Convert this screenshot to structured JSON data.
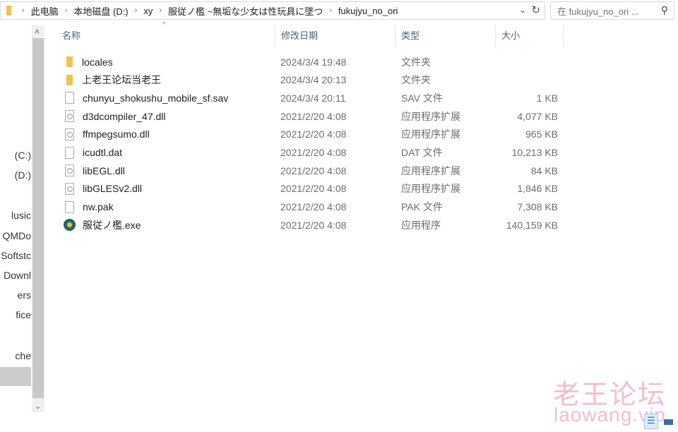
{
  "address_bar": {
    "crumbs": [
      "此电脑",
      "本地磁盘 (D:)",
      "xy",
      "服従ノ檻 ~無垢な少女は性玩具に墜つ",
      "fukujyu_no_ori"
    ]
  },
  "search": {
    "placeholder": "在 fukujyu_no_ori ..."
  },
  "nav": {
    "items": [
      {
        "label": "(C:)"
      },
      {
        "label": "(D:)"
      },
      {
        "label": "lusic"
      },
      {
        "label": "QMDo"
      },
      {
        "label": "Softstc"
      },
      {
        "label": "Downl"
      },
      {
        "label": "ers"
      },
      {
        "label": "fice"
      },
      {
        "label": "che"
      }
    ]
  },
  "columns": {
    "name": "名称",
    "date": "修改日期",
    "type": "类型",
    "size": "大小"
  },
  "files": [
    {
      "name": "locales",
      "date": "2024/3/4 19:48",
      "type": "文件夹",
      "size": "",
      "icon": "folder"
    },
    {
      "name": "上老王论坛当老王",
      "date": "2024/3/4 20:13",
      "type": "文件夹",
      "size": "",
      "icon": "folder"
    },
    {
      "name": "chunyu_shokushu_mobile_sf.sav",
      "date": "2024/3/4 20:11",
      "type": "SAV 文件",
      "size": "1 KB",
      "icon": "file"
    },
    {
      "name": "d3dcompiler_47.dll",
      "date": "2021/2/20 4:08",
      "type": "应用程序扩展",
      "size": "4,077 KB",
      "icon": "dll"
    },
    {
      "name": "ffmpegsumo.dll",
      "date": "2021/2/20 4:08",
      "type": "应用程序扩展",
      "size": "965 KB",
      "icon": "dll"
    },
    {
      "name": "icudtl.dat",
      "date": "2021/2/20 4:08",
      "type": "DAT 文件",
      "size": "10,213 KB",
      "icon": "file"
    },
    {
      "name": "libEGL.dll",
      "date": "2021/2/20 4:08",
      "type": "应用程序扩展",
      "size": "84 KB",
      "icon": "dll"
    },
    {
      "name": "libGLESv2.dll",
      "date": "2021/2/20 4:08",
      "type": "应用程序扩展",
      "size": "1,846 KB",
      "icon": "dll"
    },
    {
      "name": "nw.pak",
      "date": "2021/2/20 4:08",
      "type": "PAK 文件",
      "size": "7,308 KB",
      "icon": "file"
    },
    {
      "name": "服従ノ檻.exe",
      "date": "2021/2/20 4:08",
      "type": "应用程序",
      "size": "140,159 KB",
      "icon": "exe"
    }
  ],
  "watermark": {
    "line1": "老王论坛",
    "line2": "laowang.vip"
  }
}
